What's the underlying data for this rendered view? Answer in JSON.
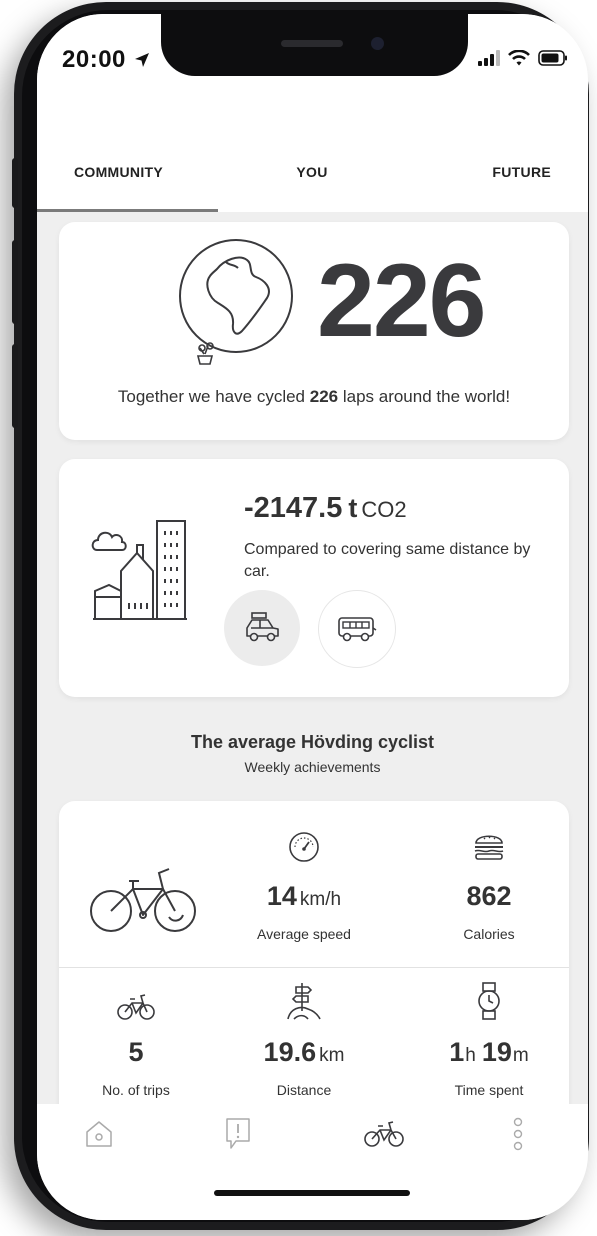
{
  "status": {
    "time": "20:00"
  },
  "tabs": [
    {
      "label": "COMMUNITY",
      "active": true
    },
    {
      "label": "YOU",
      "active": false
    },
    {
      "label": "FUTURE",
      "active": false
    }
  ],
  "laps": {
    "count": "226",
    "text_before": "Together we have cycled ",
    "text_count": "226",
    "text_after": " laps around the world!"
  },
  "co2": {
    "value": "-2147.5",
    "unit": "t",
    "unit_gas": "CO2",
    "description": "Compared to covering same distance by car.",
    "compare_options": [
      {
        "icon": "car-icon",
        "selected": true
      },
      {
        "icon": "bus-icon",
        "selected": false
      }
    ]
  },
  "average": {
    "title": "The average Hövding cyclist",
    "subtitle": "Weekly achievements",
    "speed": {
      "value": "14",
      "unit": "km/h",
      "label": "Average speed"
    },
    "calories": {
      "value": "862",
      "label": "Calories"
    },
    "trips": {
      "value": "5",
      "label": "No. of trips"
    },
    "distance": {
      "value": "19.6",
      "unit": "km",
      "label": "Distance"
    },
    "time": {
      "hours": "1",
      "h_unit": "h",
      "minutes": "19",
      "m_unit": "m",
      "label": "Time spent"
    }
  },
  "nav": {
    "items": [
      {
        "icon": "home-icon"
      },
      {
        "icon": "alert-icon"
      },
      {
        "icon": "bicycle-icon"
      },
      {
        "icon": "more-icon"
      }
    ]
  },
  "colors": {
    "background": "#efefef",
    "card": "#ffffff",
    "text": "#333333",
    "tab_indicator": "#7b7b7b",
    "selected_circle": "#ececec"
  }
}
